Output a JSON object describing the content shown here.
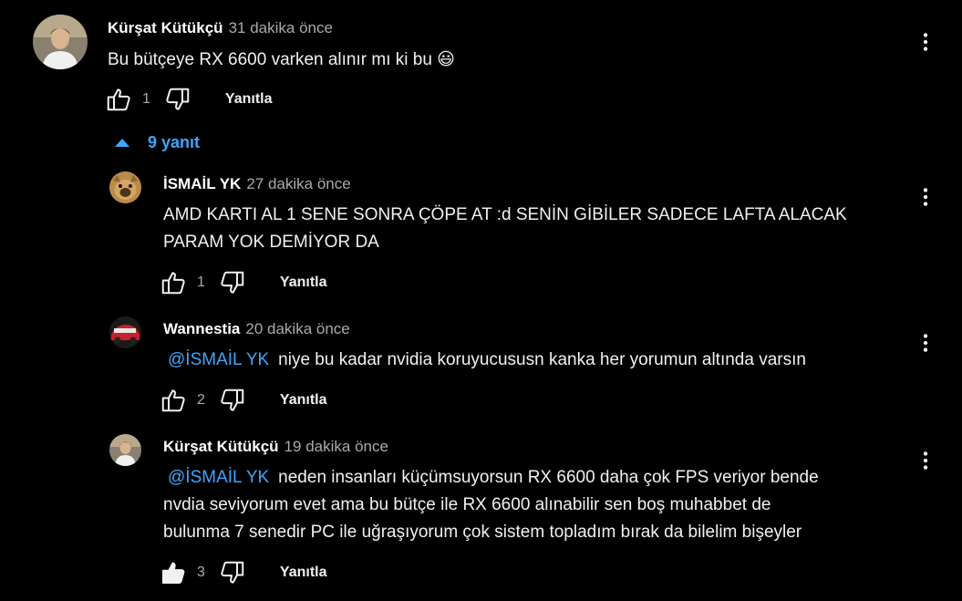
{
  "comments": [
    {
      "author": "Kürşat Kütükçü",
      "time": "31 dakika önce",
      "text": "Bu bütçeye RX 6600 varken alınır mı ki bu 😃",
      "likes": "1",
      "reply_label": "Yanıtla"
    }
  ],
  "replies_toggle": {
    "label": "9 yanıt"
  },
  "replies": [
    {
      "author": "İSMAİL YK",
      "time": "27 dakika önce",
      "lines": [
        "AMD KARTI AL 1 SENE SONRA ÇÖPE AT :d SENİN GİBİLER SADECE LAFTA ALACAK",
        "PARAM YOK DEMİYOR DA"
      ],
      "likes": "1",
      "reply_label": "Yanıtla"
    },
    {
      "author": "Wannestia",
      "time": "20 dakika önce",
      "mention": "@İSMAİL YK",
      "text": "niye bu kadar nvidia koruyucususn kanka her yorumun altında varsın",
      "likes": "2",
      "reply_label": "Yanıtla"
    },
    {
      "author": "Kürşat Kütükçü",
      "time": "19 dakika önce",
      "mention": "@İSMAİL YK",
      "line1": "neden insanları küçümsuyorsun RX 6600 daha çok FPS veriyor bende",
      "line2": "nvdia seviyorum evet ama bu bütçe ile RX 6600 alınabilir sen boş muhabbet de",
      "line3": "bulunma 7 senedir PC ile uğraşıyorum çok sistem topladım bırak da bilelim bişeyler",
      "likes": "3",
      "liked": true,
      "reply_label": "Yanıtla"
    }
  ],
  "colors": {
    "background": "#000000",
    "link": "#3ea6ff",
    "secondary_text": "#aaaaaa"
  }
}
